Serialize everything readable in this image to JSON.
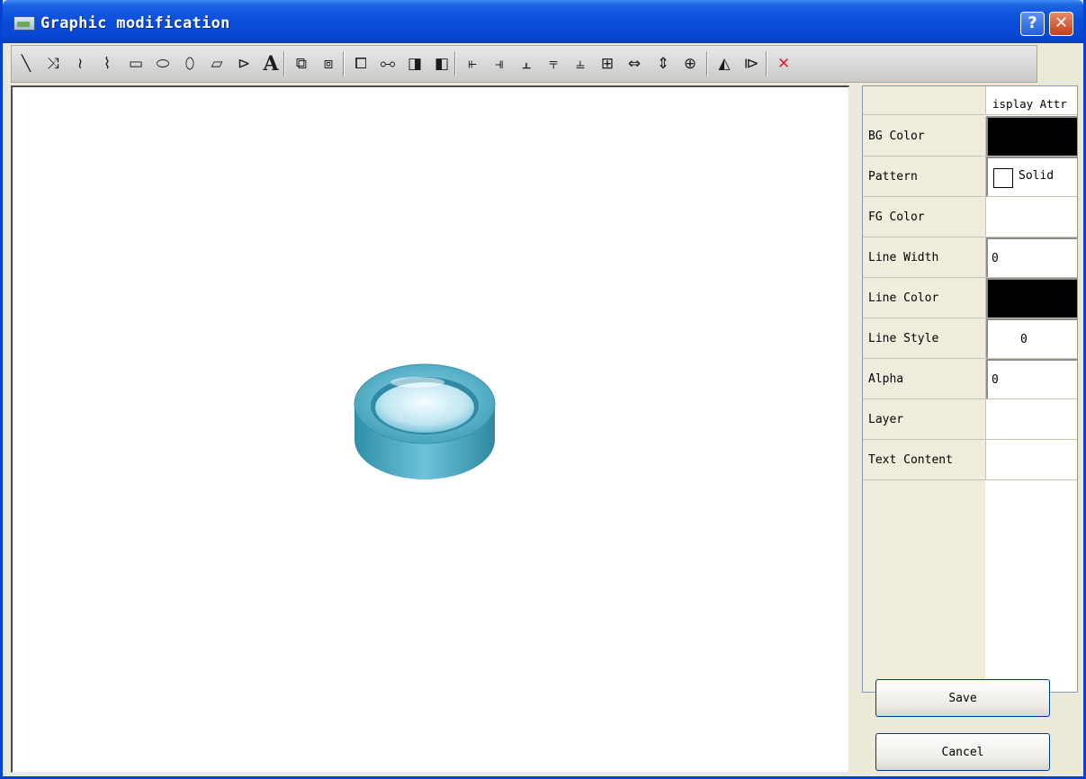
{
  "window": {
    "title": "Graphic modification",
    "help_label": "?",
    "close_label": "✕"
  },
  "toolbar": {
    "tools": [
      {
        "name": "line-tool-icon",
        "glyph": "╲"
      },
      {
        "name": "polyline-tool-icon",
        "glyph": "⤨"
      },
      {
        "name": "curve-tool-icon",
        "glyph": "≀"
      },
      {
        "name": "freehand-tool-icon",
        "glyph": "⌇"
      },
      {
        "name": "rectangle-tool-icon",
        "glyph": "▭"
      },
      {
        "name": "rounded-rect-tool-icon",
        "glyph": "⬭"
      },
      {
        "name": "ellipse-tool-icon",
        "glyph": "⬯"
      },
      {
        "name": "parallelogram-tool-icon",
        "glyph": "▱"
      },
      {
        "name": "polygon-tool-icon",
        "glyph": "⊳"
      },
      {
        "name": "text-tool-icon",
        "glyph": "A"
      },
      {
        "name": "group-icon",
        "glyph": "⧉"
      },
      {
        "name": "ungroup-icon",
        "glyph": "⧈"
      },
      {
        "name": "bring-to-front-icon",
        "glyph": "⧠"
      },
      {
        "name": "send-to-back-icon",
        "glyph": "⧟"
      },
      {
        "name": "bring-forward-icon",
        "glyph": "◨"
      },
      {
        "name": "send-backward-icon",
        "glyph": "◧"
      },
      {
        "name": "align-left-icon",
        "glyph": "⫦"
      },
      {
        "name": "align-right-icon",
        "glyph": "⫣"
      },
      {
        "name": "align-center-horizontal-icon",
        "glyph": "⫠"
      },
      {
        "name": "align-top-icon",
        "glyph": "⫧"
      },
      {
        "name": "align-bottom-icon",
        "glyph": "⫨"
      },
      {
        "name": "align-center-vertical-icon",
        "glyph": "⊞"
      },
      {
        "name": "same-width-icon",
        "glyph": "⇔"
      },
      {
        "name": "same-height-icon",
        "glyph": "⇕"
      },
      {
        "name": "same-size-icon",
        "glyph": "⊕"
      },
      {
        "name": "flip-horizontal-icon",
        "glyph": "◭"
      },
      {
        "name": "flip-vertical-icon",
        "glyph": "⧐"
      },
      {
        "name": "delete-icon",
        "glyph": "✕"
      }
    ]
  },
  "properties": {
    "header": "isplay Attr",
    "rows": [
      {
        "label": "BG Color",
        "value": "",
        "kind": "color",
        "color": "#000000"
      },
      {
        "label": "Pattern",
        "value": "Solid",
        "kind": "pattern"
      },
      {
        "label": "FG Color",
        "value": "",
        "kind": "empty"
      },
      {
        "label": "Line Width",
        "value": "0",
        "kind": "field"
      },
      {
        "label": "Line Color",
        "value": "",
        "kind": "color",
        "color": "#000000"
      },
      {
        "label": "Line Style",
        "value": "0",
        "kind": "center"
      },
      {
        "label": "Alpha",
        "value": "0",
        "kind": "field"
      },
      {
        "label": "Layer",
        "value": "",
        "kind": "empty"
      },
      {
        "label": "Text Content",
        "value": "",
        "kind": "empty"
      }
    ]
  },
  "buttons": {
    "save": "Save",
    "cancel": "Cancel"
  },
  "colors": {
    "titlebar": "#0a4ddb",
    "shape_body": "#4aa8c0",
    "shape_top": "#bfe9f5"
  }
}
